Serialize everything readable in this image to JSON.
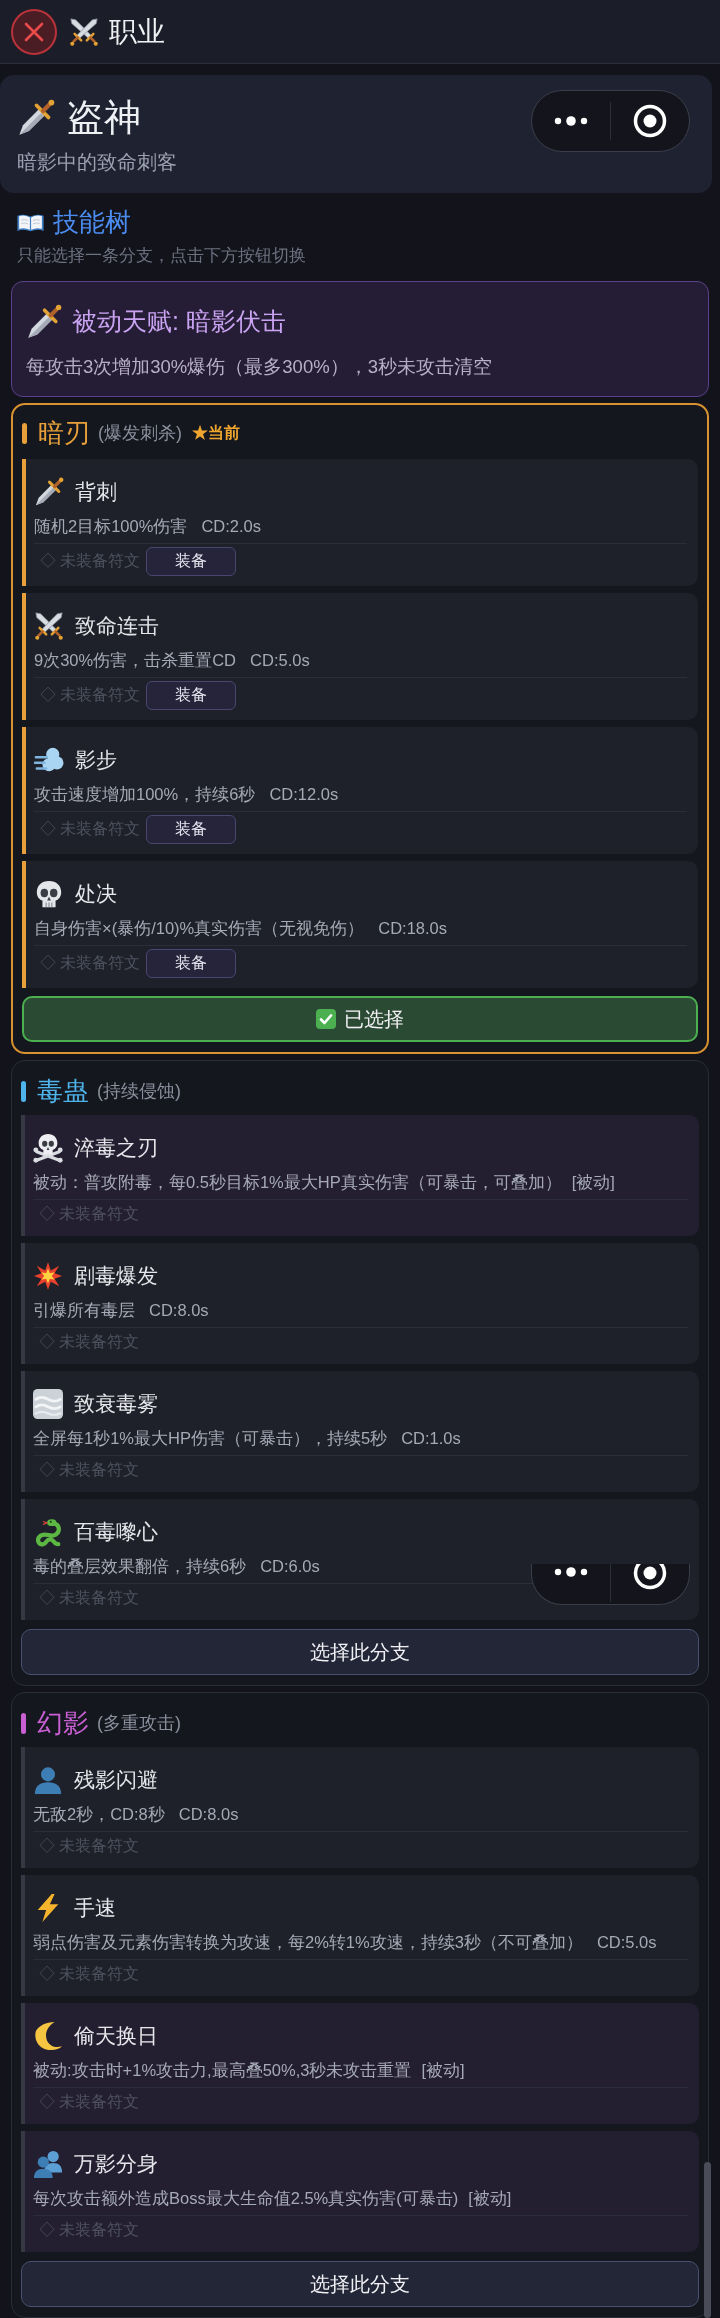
{
  "header": {
    "title": "职业"
  },
  "class_card": {
    "name": "盗神",
    "subtitle": "暗影中的致命刺客"
  },
  "skill_tree": {
    "title": "技能树",
    "hint": "只能选择一条分支，点击下方按钮切换"
  },
  "passive_talent": {
    "title": "被动天赋: 暗影伏击",
    "description": "每攻击3次增加30%爆伤（最多300%），3秒未攻击清空"
  },
  "branches": [
    {
      "name": "暗刃",
      "subtitle": "(爆发刺杀)",
      "badge": "★当前",
      "color": "#e8a13a",
      "selected": true,
      "button": "已选择",
      "skills": [
        {
          "name": "背刺",
          "kind": "active",
          "description": "随机2目标100%伤害",
          "cooldown": "CD:2.0s",
          "rune": "◇ 未装备符文",
          "equip_button": "装备"
        },
        {
          "name": "致命连击",
          "kind": "active",
          "description": "9次30%伤害，击杀重置CD",
          "cooldown": "CD:5.0s",
          "rune": "◇ 未装备符文",
          "equip_button": "装备"
        },
        {
          "name": "影步",
          "kind": "active",
          "description": "攻击速度增加100%，持续6秒",
          "cooldown": "CD:12.0s",
          "rune": "◇ 未装备符文",
          "equip_button": "装备"
        },
        {
          "name": "处决",
          "kind": "active",
          "description": "自身伤害×(暴伤/10)%真实伤害（无视免伤）",
          "cooldown": "CD:18.0s",
          "rune": "◇ 未装备符文",
          "equip_button": "装备"
        }
      ]
    },
    {
      "name": "毒蛊",
      "subtitle": "(持续侵蚀)",
      "color": "#4db3ea",
      "selected": false,
      "button": "选择此分支",
      "skills": [
        {
          "name": "淬毒之刃",
          "kind": "passive",
          "description": "被动：普攻附毒，每0.5秒目标1%最大HP真实伤害（可暴击，可叠加）",
          "tag": "[被动]",
          "rune": "◇ 未装备符文"
        },
        {
          "name": "剧毒爆发",
          "kind": "active",
          "description": "引爆所有毒层",
          "cooldown": "CD:8.0s",
          "rune": "◇ 未装备符文"
        },
        {
          "name": "致衰毒雾",
          "kind": "active",
          "description": "全屏每1秒1%最大HP伤害（可暴击），持续5秒",
          "cooldown": "CD:1.0s",
          "rune": "◇ 未装备符文"
        },
        {
          "name": "百毒嚟心",
          "kind": "active",
          "description": "毒的叠层效果翻倍，持续6秒",
          "cooldown": "CD:6.0s",
          "rune": "◇ 未装备符文"
        }
      ]
    },
    {
      "name": "幻影",
      "subtitle": "(多重攻击)",
      "color": "#c85fd3",
      "selected": false,
      "button": "选择此分支",
      "skills": [
        {
          "name": "残影闪避",
          "kind": "active",
          "description": "无敌2秒，CD:8秒",
          "cooldown": "CD:8.0s",
          "rune": "◇ 未装备符文"
        },
        {
          "name": "手速",
          "kind": "active",
          "description": "弱点伤害及元素伤害转换为攻速，每2%转1%攻速，持续3秒（不可叠加）",
          "cooldown": "CD:5.0s",
          "rune": "◇ 未装备符文"
        },
        {
          "name": "偷天换日",
          "kind": "passive",
          "description": "被动:攻击时+1%攻击力,最高叠50%,3秒未攻击重置",
          "tag": "[被动]",
          "rune": "◇ 未装备符文"
        },
        {
          "name": "万影分身",
          "kind": "passive",
          "description": "每次攻击额外造成Boss最大生命值2.5%真实伤害(可暴击)",
          "tag": "[被动]",
          "rune": "◇ 未装备符文"
        }
      ]
    }
  ]
}
